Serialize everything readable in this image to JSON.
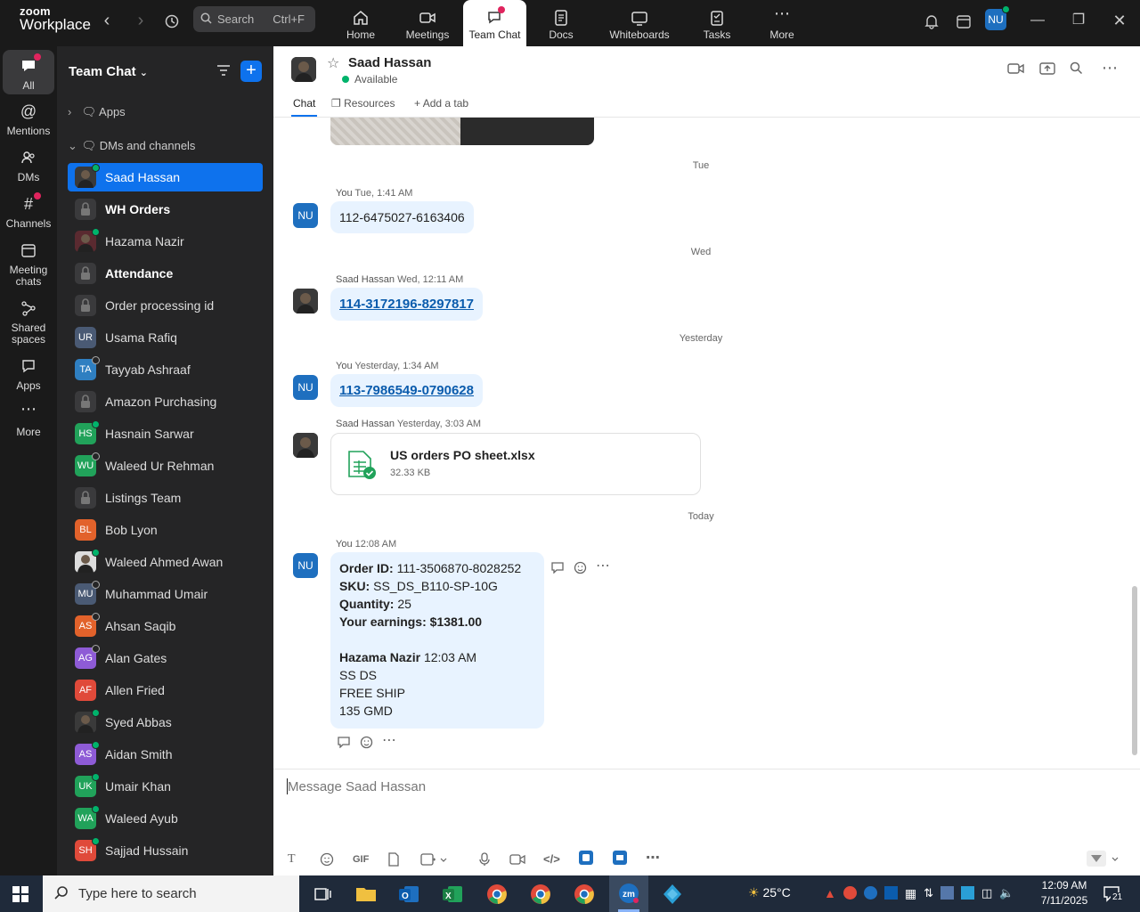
{
  "app": {
    "brand_line1": "zoom",
    "brand_line2": "Workplace",
    "search_label": "Search",
    "search_shortcut": "Ctrl+F",
    "user_initials": "NU"
  },
  "top_tabs": [
    {
      "label": "Home",
      "icon": "home-icon"
    },
    {
      "label": "Meetings",
      "icon": "video-icon"
    },
    {
      "label": "Team Chat",
      "icon": "chat-icon",
      "active": true
    },
    {
      "label": "Docs",
      "icon": "doc-icon"
    },
    {
      "label": "Whiteboards",
      "icon": "whiteboard-icon"
    },
    {
      "label": "Tasks",
      "icon": "tasks-icon"
    },
    {
      "label": "More",
      "icon": "more-icon"
    }
  ],
  "rail": [
    {
      "label": "All",
      "icon": "chat-icon",
      "active": true
    },
    {
      "label": "Mentions",
      "icon": "at-icon"
    },
    {
      "label": "DMs",
      "icon": "people-icon"
    },
    {
      "label": "Channels",
      "icon": "hash-icon"
    },
    {
      "label": "Meeting chats",
      "icon": "calendar-icon"
    },
    {
      "label": "Shared spaces",
      "icon": "share-icon"
    },
    {
      "label": "Apps",
      "icon": "apps-icon"
    },
    {
      "label": "More",
      "icon": "more-icon"
    }
  ],
  "sidebar": {
    "title": "Team Chat",
    "section_apps": "Apps",
    "section_dms": "DMs and channels",
    "items": [
      {
        "name": "Saad Hassan",
        "avatar": "photo",
        "status": "on",
        "active": true
      },
      {
        "name": "WH Orders",
        "avatar": "lock",
        "bold": true
      },
      {
        "name": "Hazama Nazir",
        "avatar": "photo-red",
        "status": "on"
      },
      {
        "name": "Attendance",
        "avatar": "lock",
        "bold": true
      },
      {
        "name": "Order processing id",
        "avatar": "lock"
      },
      {
        "name": "Usama Rafiq",
        "initials": "UR",
        "color": "#4a5a74"
      },
      {
        "name": "Tayyab Ashraaf",
        "initials": "TA",
        "color": "#2f7fc1",
        "status": "off"
      },
      {
        "name": "Amazon Purchasing",
        "avatar": "lock"
      },
      {
        "name": "Hasnain Sarwar",
        "initials": "HS",
        "color": "#21a25a",
        "status": "on"
      },
      {
        "name": "Waleed Ur Rehman",
        "initials": "WU",
        "color": "#21a25a",
        "status": "off"
      },
      {
        "name": "Listings Team",
        "avatar": "lock"
      },
      {
        "name": "Bob Lyon",
        "initials": "BL",
        "color": "#e2622b"
      },
      {
        "name": "Waleed Ahmed Awan",
        "avatar": "photo-white",
        "status": "on"
      },
      {
        "name": "Muhammad Umair",
        "initials": "MU",
        "color": "#4a5a74",
        "status": "off"
      },
      {
        "name": "Ahsan Saqib",
        "initials": "AS",
        "color": "#e2622b",
        "status": "off"
      },
      {
        "name": "Alan Gates",
        "initials": "AG",
        "color": "#8e5bd6",
        "status": "off"
      },
      {
        "name": "Allen Fried",
        "initials": "AF",
        "color": "#e04a3a"
      },
      {
        "name": "Syed Abbas",
        "avatar": "photo",
        "status": "on"
      },
      {
        "name": "Aidan Smith",
        "initials": "AS",
        "color": "#8e5bd6",
        "status": "on"
      },
      {
        "name": "Umair Khan",
        "initials": "UK",
        "color": "#21a25a",
        "status": "on"
      },
      {
        "name": "Waleed Ayub",
        "initials": "WA",
        "color": "#21a25a",
        "status": "on"
      },
      {
        "name": "Sajjad Hussain",
        "initials": "SH",
        "color": "#e04a3a",
        "status": "on"
      }
    ]
  },
  "chat": {
    "peer_name": "Saad Hassan",
    "peer_status": "Available",
    "tabs": [
      "Chat",
      "Resources",
      "Add a tab"
    ],
    "day_tue": "Tue",
    "day_wed": "Wed",
    "day_yesterday": "Yesterday",
    "day_today": "Today",
    "m1_author": "You",
    "m1_time": "Tue, 1:41 AM",
    "m1_text": "112-6475027-6163406",
    "m2_author": "Saad Hassan",
    "m2_time": "Wed, 12:11 AM",
    "m2_text": "114-3172196-8297817",
    "m3_author": "You",
    "m3_time": "Yesterday, 1:34 AM",
    "m3_text": "113-7986549-0790628",
    "m4_author": "Saad Hassan",
    "m4_time": "Yesterday, 3:03 AM",
    "m4_file_name": "US orders PO sheet.xlsx",
    "m4_file_size": "32.33 KB",
    "m5_author": "You",
    "m5_time": "12:08 AM",
    "m5": {
      "order_label": "Order ID:",
      "order_value": "111-3506870-8028252",
      "sku_label": "SKU:",
      "sku_value": "SS_DS_B110-SP-10G",
      "qty_label": "Quantity:",
      "qty_value": "25",
      "earn_label": "Your earnings:",
      "earn_value": "$1381.00",
      "quote_author": "Hazama Nazir",
      "quote_time": "12:03 AM",
      "line1": "SS DS",
      "line2": "FREE SHIP",
      "line3": "135 GMD"
    },
    "composer_placeholder": "Message Saad Hassan",
    "gif_label": "GIF"
  },
  "taskbar": {
    "search_placeholder": "Type here to search",
    "weather": "25°C",
    "time": "12:09 AM",
    "date": "7/11/2025",
    "notif_count": "21"
  },
  "colors": {
    "accent": "#0e72ed",
    "online": "#00b36b",
    "bubble": "#e8f3ff"
  }
}
